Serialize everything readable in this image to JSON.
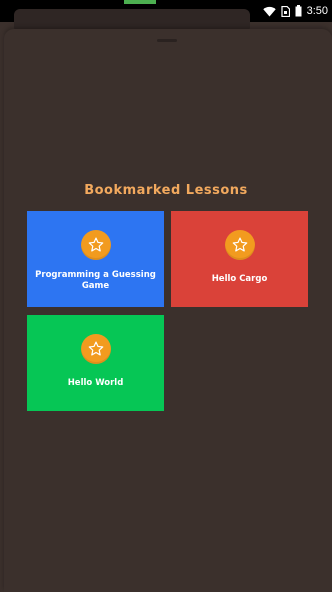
{
  "status_bar": {
    "time": "3:50",
    "icons": [
      "wifi-icon",
      "sim-icon",
      "battery-icon"
    ]
  },
  "page": {
    "title": "Bookmarked Lessons"
  },
  "lessons": [
    {
      "label": "Programming a Guessing Game",
      "color": "#2d75f2",
      "icon": "star-icon"
    },
    {
      "label": "Hello Cargo",
      "color": "#da4239",
      "icon": "star-icon"
    },
    {
      "label": "Hello World",
      "color": "#06c655",
      "icon": "star-icon"
    }
  ],
  "colors": {
    "background": "#3b302c",
    "title": "#f2a95e",
    "star_badge": "#f29b1f"
  }
}
